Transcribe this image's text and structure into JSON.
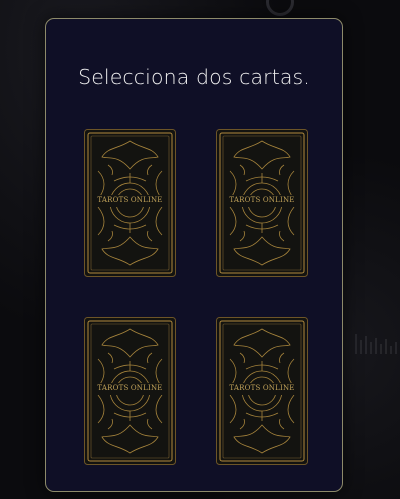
{
  "panel": {
    "title": "Selecciona dos cartas."
  },
  "cards": [
    {
      "label": "TAROTS ONLINE"
    },
    {
      "label": "TAROTS ONLINE"
    },
    {
      "label": "TAROTS ONLINE"
    },
    {
      "label": "TAROTS ONLINE"
    }
  ],
  "colors": {
    "panel_bg": "#0f0f26",
    "panel_border": "#8d8a6a",
    "card_bg": "#131310",
    "card_gold": "#b08a3e",
    "text": "#f1f1f1"
  },
  "icons": {
    "card_back": "ornate-card-back-icon"
  }
}
